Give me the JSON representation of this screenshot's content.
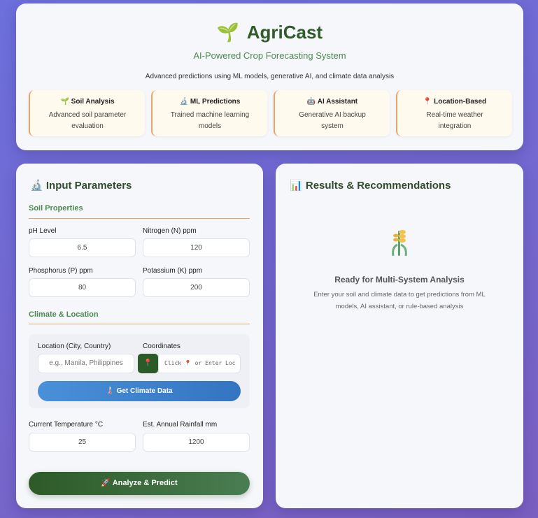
{
  "header": {
    "brand_icon": "🌱",
    "title": "AgriCast",
    "tagline": "AI-Powered Crop Forecasting System",
    "description": "Advanced predictions using ML models, generative AI, and climate data analysis",
    "features": [
      {
        "icon": "🌱",
        "title": "Soil Analysis",
        "desc": "Advanced soil parameter evaluation"
      },
      {
        "icon": "🔬",
        "title": "ML Predictions",
        "desc": "Trained machine learning models"
      },
      {
        "icon": "🤖",
        "title": "AI Assistant",
        "desc": "Generative AI backup system"
      },
      {
        "icon": "📍",
        "title": "Location-Based",
        "desc": "Real-time weather integration"
      }
    ]
  },
  "inputs": {
    "icon": "🔬",
    "title": "Input Parameters",
    "soil_section": "Soil Properties",
    "ph_label": "pH Level",
    "ph_value": "6.5",
    "nitrogen_label": "Nitrogen (N) ppm",
    "nitrogen_value": "120",
    "phosphorus_label": "Phosphorus (P) ppm",
    "phosphorus_value": "80",
    "potassium_label": "Potassium (K) ppm",
    "potassium_value": "200",
    "climate_section": "Climate & Location",
    "location_label": "Location (City, Country)",
    "location_placeholder": "e.g., Manila, Philippines",
    "coordinates_label": "Coordinates",
    "pin_icon": "📍",
    "coordinates_placeholder": "Click 📍 or Enter Loc",
    "climate_button": "🌡️ Get Climate Data",
    "temperature_label": "Current Temperature °C",
    "temperature_value": "25",
    "rainfall_label": "Est. Annual Rainfall mm",
    "rainfall_value": "1200",
    "analyze_button": "🚀 Analyze & Predict"
  },
  "results": {
    "icon": "📊",
    "title": "Results & Recommendations",
    "ready_title": "Ready for Multi-System Analysis",
    "ready_hint": "Enter your soil and climate data to get predictions from ML models, AI assistant, or rule-based analysis"
  },
  "colors": {
    "brand_green": "#2f5c2a",
    "accent_orange": "#e8a26a",
    "climate_blue": "#3474c0"
  }
}
